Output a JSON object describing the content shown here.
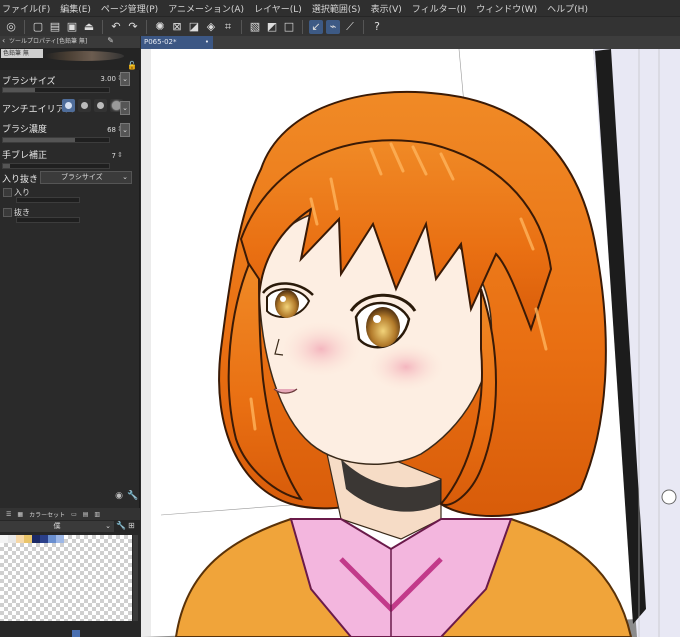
{
  "menu": [
    "ファイル(F)",
    "編集(E)",
    "ページ管理(P)",
    "アニメーション(A)",
    "レイヤー(L)",
    "選択範囲(S)",
    "表示(V)",
    "フィルター(I)",
    "ウィンドウ(W)",
    "ヘルプ(H)"
  ],
  "tool_property": {
    "title": "ツールプロパティ[色鉛筆 無]",
    "brush_name": "色鉛筆 無",
    "brush_size_label": "ブラシサイズ",
    "brush_size_value": "3.00",
    "brush_size_level": 0.3,
    "antialias_label": "アンチエイリアス",
    "brush_density_label": "ブラシ濃度",
    "brush_density_value": "68",
    "brush_density_level": 0.68,
    "stabilization_label": "手ブレ補正",
    "stabilization_value": "7",
    "stabilization_level": 0.07,
    "taper_label": "入り抜き",
    "taper_select": "ブラシサイズ",
    "in_label": "入り",
    "out_label": "抜き"
  },
  "color_panel": {
    "tab_label": "カラーセット",
    "set_name": "僕",
    "swatches": [
      "#f4f4f4",
      "#e8e8e8",
      "#f6d8a8",
      "#e9c46a",
      "#1c2a66",
      "#2a3f8a",
      "#6a8fd0",
      "#9db7e6"
    ]
  },
  "document": {
    "tab_title": "P065-02*"
  },
  "colors": {
    "accent": "#3c5784",
    "hair": "#e87b1c",
    "shirt": "#f3b6de",
    "jacket": "#f0a43a"
  }
}
